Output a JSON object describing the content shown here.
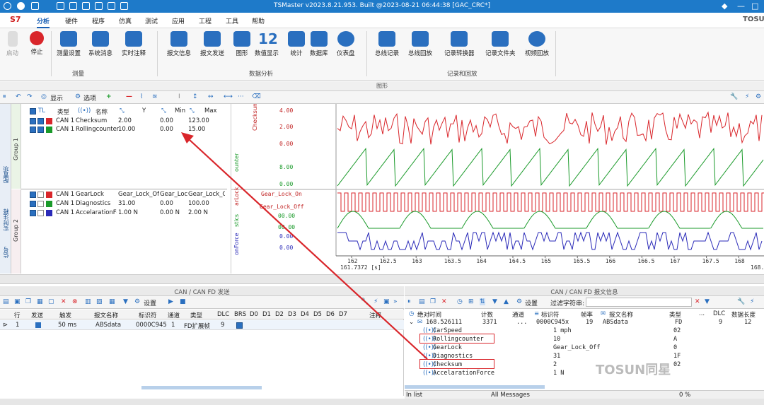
{
  "window": {
    "title": "TSMaster v2023.8.21.953. Built @2023-08-21 06:44:38 [GAC_CRC*]",
    "brand": "TOSUN"
  },
  "menu": {
    "items": [
      "分析",
      "硬件",
      "程序",
      "仿真",
      "测试",
      "应用",
      "工程",
      "工具",
      "帮助"
    ]
  },
  "ribbon": {
    "buttons": [
      "启动",
      "停止",
      "测量设置",
      "系统消息",
      "实时注释",
      "报文信息",
      "报文发送",
      "图形",
      "数值显示",
      "统计",
      "数据库",
      "仪表盘",
      "总线记录",
      "总线回放",
      "记录转换器",
      "记录文件夹",
      "视频回放"
    ],
    "number_icon": "12",
    "groups": [
      "测量",
      "数据分析",
      "记录和回放"
    ]
  },
  "graph": {
    "panel_title": "图形",
    "toolbar": {
      "display": "显示",
      "options": "选项"
    },
    "side_tabs": [
      "配置项",
      "实时注释",
      "信号"
    ],
    "groups": [
      "Group 1",
      "Group 2"
    ],
    "headers": [
      "类型",
      "名称",
      "Y",
      "Min",
      "Max"
    ],
    "group1_rows": [
      {
        "type": "CAN 1",
        "name": "Checksum",
        "y": "2.00",
        "min": "0.00",
        "max": "123.00"
      },
      {
        "type": "CAN 1",
        "name": "Rollingcounter",
        "y": "10.00",
        "min": "0.00",
        "max": "15.00"
      }
    ],
    "group2_rows": [
      {
        "type": "CAN 1",
        "name": "GearLock",
        "y": "Gear_Lock_Off",
        "min": "Gear_Lock",
        "max": "Gear_Lock_O"
      },
      {
        "type": "CAN 1",
        "name": "Diagnostics",
        "y": "31.00",
        "min": "0.00",
        "max": "100.00"
      },
      {
        "type": "CAN 1",
        "name": "AccelarationFor",
        "y": "1.00 N",
        "min": "0.00 N",
        "max": "2.00 N"
      }
    ],
    "axis_labels": {
      "checksum": [
        "4.00",
        "2.00",
        "0.00"
      ],
      "rolling": [
        "8.00",
        "0.00"
      ],
      "gear": [
        "Gear_Lock_On",
        "Gear_Lock_Off"
      ],
      "diag": [
        "00.00",
        "00.00"
      ],
      "accel": [
        "0.00",
        "0.00"
      ]
    },
    "axis_names": [
      "Checksum",
      "ounter",
      "arLock",
      "stics",
      "onForce"
    ],
    "x_ticks": [
      "162",
      "162.5",
      "163",
      "163.5",
      "164",
      "164.5",
      "165",
      "165.5",
      "166",
      "166.5",
      "167",
      "167.5",
      "168"
    ],
    "x_left": "161.7372 [s]",
    "x_right": "168."
  },
  "tx": {
    "title": "CAN / CAN FD 发送",
    "settings": "设置",
    "headers": [
      "行",
      "发送",
      "触发",
      "报文名称",
      "标识符",
      "通道",
      "类型",
      "DLC",
      "BRS",
      "D0",
      "D1",
      "D2",
      "D3",
      "D4",
      "D5",
      "D6",
      "D7",
      "注释"
    ],
    "row": {
      "idx": "1",
      "trigger": "50 ms",
      "name": "ABSdata",
      "id": "0000C945",
      "ch": "1",
      "type": "FD扩展帧",
      "dlc": "9"
    }
  },
  "rx": {
    "title": "CAN / CAN FD 报文信息",
    "settings": "设置",
    "filter_label": "过滤字符串:",
    "headers": [
      "绝对时间",
      "计数",
      "通道",
      "标识符",
      "帧率",
      "报文名称",
      "类型",
      "DLC",
      "数据长度"
    ],
    "msg": {
      "time": "168.526111",
      "count": "3371",
      "ch": "...",
      "id": "0000C945x",
      "rate": "19",
      "name": "ABSdata",
      "type": "FD",
      "dlc": "9",
      "len": "12"
    },
    "signals": [
      {
        "name": "CarSpeed",
        "value": "1 mph",
        "raw": "02"
      },
      {
        "name": "Rollingcounter",
        "value": "10",
        "raw": "A"
      },
      {
        "name": "GearLock",
        "value": "Gear_Lock_Off",
        "raw": "0"
      },
      {
        "name": "Diagnostics",
        "value": "31",
        "raw": "1F"
      },
      {
        "name": "Checksum",
        "value": "2",
        "raw": "02"
      },
      {
        "name": "AccelarationForce",
        "value": "1 N",
        "raw": ""
      }
    ],
    "status": {
      "in_list": "In list",
      "all_messages": "All Messages",
      "percent": "0 %"
    }
  },
  "watermark": "TOSUN同星",
  "colors": {
    "accent": "#1e7ac9",
    "red": "#d9262b",
    "green": "#1a9a2a",
    "blue": "#2a2ab8"
  }
}
